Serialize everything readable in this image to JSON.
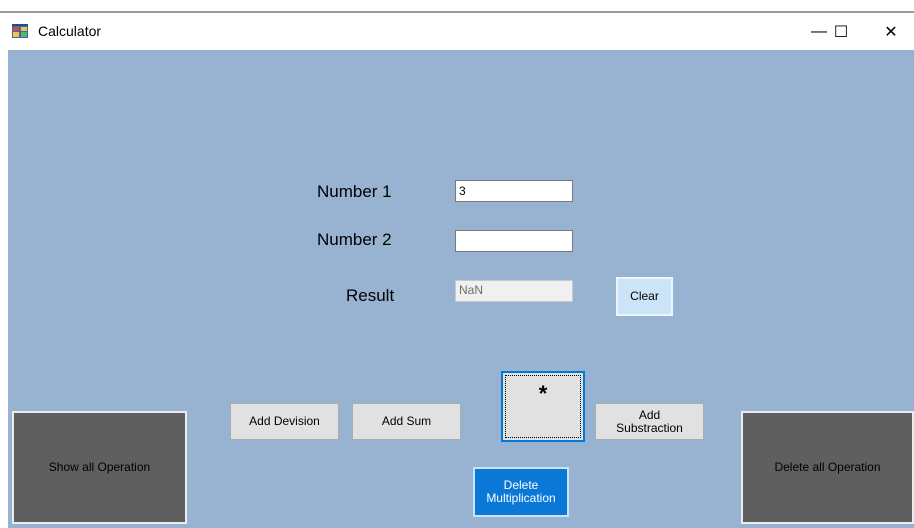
{
  "window": {
    "title": "Calculator",
    "controls": {
      "minimize": "—",
      "maximize": "☐",
      "close": "✕"
    }
  },
  "form": {
    "number1": {
      "label": "Number 1",
      "value": "3"
    },
    "number2": {
      "label": "Number 2",
      "value": ""
    },
    "result": {
      "label": "Result",
      "value": "NaN"
    },
    "clear_label": "Clear"
  },
  "buttons": {
    "show_all": "Show all Operation",
    "add_division": "Add Devision",
    "add_sum": "Add Sum",
    "multiply": "*",
    "add_subtraction": "Add\nSubstraction",
    "delete_multiplication": "Delete\nMultiplication",
    "delete_all": "Delete all Operation"
  },
  "colors": {
    "client_bg": "#98b2d2",
    "dark_button": "#5f5f5f",
    "accent_button": "#0a78d7",
    "focus_border": "#0078d7"
  }
}
